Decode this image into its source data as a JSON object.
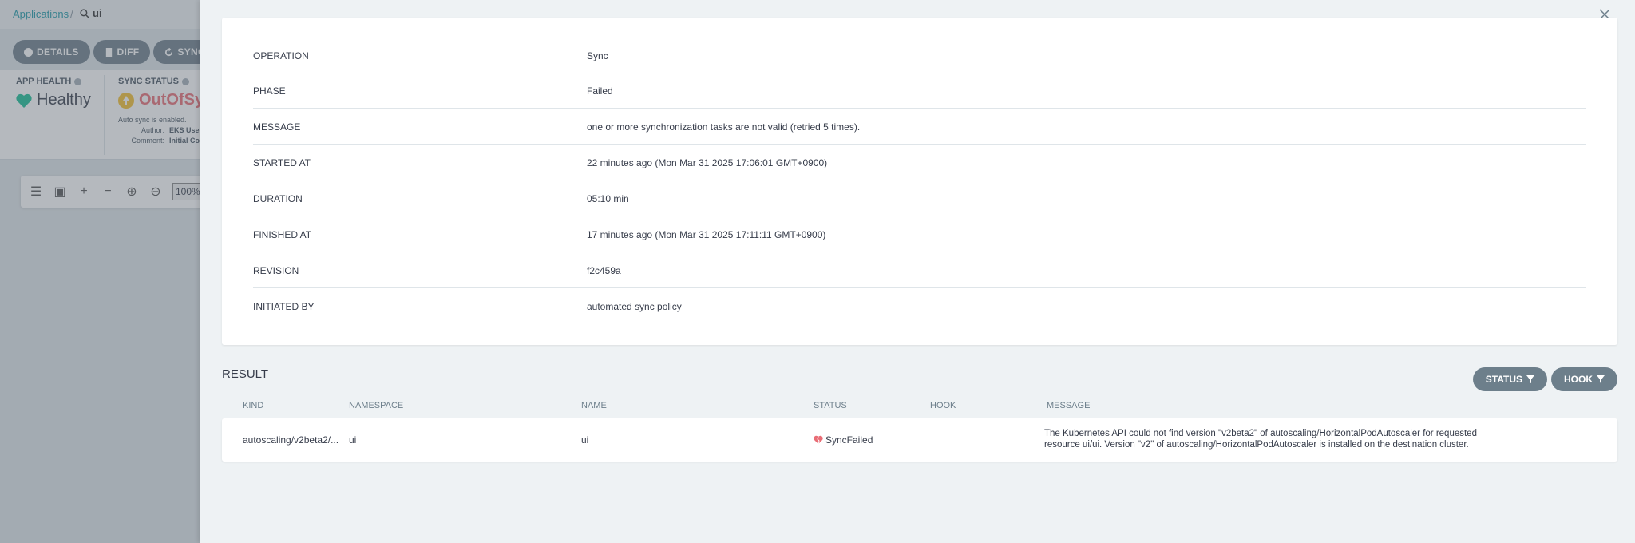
{
  "breadcrumb": {
    "applications": "Applications",
    "search": "ui"
  },
  "toolbar": {
    "details": "DETAILS",
    "diff": "DIFF",
    "sync": "SYNC"
  },
  "health": {
    "app_health_label": "APP HEALTH",
    "app_health_value": "Healthy",
    "sync_status_label": "SYNC STATUS",
    "sync_status_value": "OutOfSyn",
    "auto_sync": "Auto sync is enabled.",
    "author_key": "Author:",
    "author_val": "EKS Use",
    "comment_key": "Comment:",
    "comment_val": "Initial Co"
  },
  "zoom": {
    "value": "100%"
  },
  "details": [
    {
      "key": "OPERATION",
      "value": "Sync"
    },
    {
      "key": "PHASE",
      "value": "Failed"
    },
    {
      "key": "MESSAGE",
      "value": "one or more synchronization tasks are not valid (retried 5 times)."
    },
    {
      "key": "STARTED AT",
      "value": "22 minutes ago (Mon Mar 31 2025 17:06:01 GMT+0900)"
    },
    {
      "key": "DURATION",
      "value": "05:10 min"
    },
    {
      "key": "FINISHED AT",
      "value": "17 minutes ago (Mon Mar 31 2025 17:11:11 GMT+0900)"
    },
    {
      "key": "REVISION",
      "value": "f2c459a"
    },
    {
      "key": "INITIATED BY",
      "value": "automated sync policy"
    }
  ],
  "result": {
    "title": "RESULT",
    "filters": {
      "status": "STATUS",
      "hook": "HOOK"
    },
    "columns": {
      "kind": "KIND",
      "namespace": "NAMESPACE",
      "name": "NAME",
      "status": "STATUS",
      "hook": "HOOK",
      "message": "MESSAGE"
    },
    "rows": [
      {
        "kind": "autoscaling/v2beta2/...",
        "namespace": "ui",
        "name": "ui",
        "status": "SyncFailed",
        "hook": "",
        "message": "The Kubernetes API could not find version \"v2beta2\" of autoscaling/HorizontalPodAutoscaler for requested resource ui/ui. Version \"v2\" of autoscaling/HorizontalPodAutoscaler is installed on the destination cluster."
      }
    ]
  },
  "colors": {
    "teal": "#1e9aa8",
    "pill": "#6d7f8b",
    "healthy": "#18be94",
    "out_of_sync": "#e96d76",
    "warning": "#f4c030"
  }
}
